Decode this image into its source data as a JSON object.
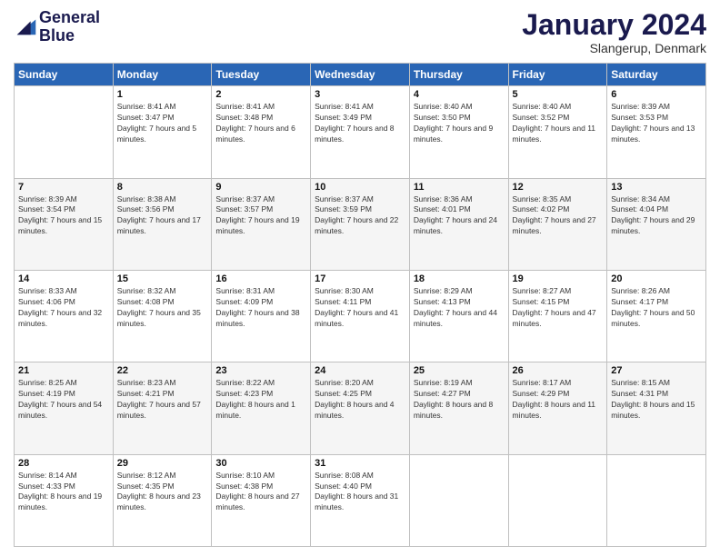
{
  "header": {
    "logo_line1": "General",
    "logo_line2": "Blue",
    "month": "January 2024",
    "location": "Slangerup, Denmark"
  },
  "weekdays": [
    "Sunday",
    "Monday",
    "Tuesday",
    "Wednesday",
    "Thursday",
    "Friday",
    "Saturday"
  ],
  "rows": [
    [
      {
        "day": "",
        "sunrise": "",
        "sunset": "",
        "daylight": ""
      },
      {
        "day": "1",
        "sunrise": "Sunrise: 8:41 AM",
        "sunset": "Sunset: 3:47 PM",
        "daylight": "Daylight: 7 hours and 5 minutes."
      },
      {
        "day": "2",
        "sunrise": "Sunrise: 8:41 AM",
        "sunset": "Sunset: 3:48 PM",
        "daylight": "Daylight: 7 hours and 6 minutes."
      },
      {
        "day": "3",
        "sunrise": "Sunrise: 8:41 AM",
        "sunset": "Sunset: 3:49 PM",
        "daylight": "Daylight: 7 hours and 8 minutes."
      },
      {
        "day": "4",
        "sunrise": "Sunrise: 8:40 AM",
        "sunset": "Sunset: 3:50 PM",
        "daylight": "Daylight: 7 hours and 9 minutes."
      },
      {
        "day": "5",
        "sunrise": "Sunrise: 8:40 AM",
        "sunset": "Sunset: 3:52 PM",
        "daylight": "Daylight: 7 hours and 11 minutes."
      },
      {
        "day": "6",
        "sunrise": "Sunrise: 8:39 AM",
        "sunset": "Sunset: 3:53 PM",
        "daylight": "Daylight: 7 hours and 13 minutes."
      }
    ],
    [
      {
        "day": "7",
        "sunrise": "Sunrise: 8:39 AM",
        "sunset": "Sunset: 3:54 PM",
        "daylight": "Daylight: 7 hours and 15 minutes."
      },
      {
        "day": "8",
        "sunrise": "Sunrise: 8:38 AM",
        "sunset": "Sunset: 3:56 PM",
        "daylight": "Daylight: 7 hours and 17 minutes."
      },
      {
        "day": "9",
        "sunrise": "Sunrise: 8:37 AM",
        "sunset": "Sunset: 3:57 PM",
        "daylight": "Daylight: 7 hours and 19 minutes."
      },
      {
        "day": "10",
        "sunrise": "Sunrise: 8:37 AM",
        "sunset": "Sunset: 3:59 PM",
        "daylight": "Daylight: 7 hours and 22 minutes."
      },
      {
        "day": "11",
        "sunrise": "Sunrise: 8:36 AM",
        "sunset": "Sunset: 4:01 PM",
        "daylight": "Daylight: 7 hours and 24 minutes."
      },
      {
        "day": "12",
        "sunrise": "Sunrise: 8:35 AM",
        "sunset": "Sunset: 4:02 PM",
        "daylight": "Daylight: 7 hours and 27 minutes."
      },
      {
        "day": "13",
        "sunrise": "Sunrise: 8:34 AM",
        "sunset": "Sunset: 4:04 PM",
        "daylight": "Daylight: 7 hours and 29 minutes."
      }
    ],
    [
      {
        "day": "14",
        "sunrise": "Sunrise: 8:33 AM",
        "sunset": "Sunset: 4:06 PM",
        "daylight": "Daylight: 7 hours and 32 minutes."
      },
      {
        "day": "15",
        "sunrise": "Sunrise: 8:32 AM",
        "sunset": "Sunset: 4:08 PM",
        "daylight": "Daylight: 7 hours and 35 minutes."
      },
      {
        "day": "16",
        "sunrise": "Sunrise: 8:31 AM",
        "sunset": "Sunset: 4:09 PM",
        "daylight": "Daylight: 7 hours and 38 minutes."
      },
      {
        "day": "17",
        "sunrise": "Sunrise: 8:30 AM",
        "sunset": "Sunset: 4:11 PM",
        "daylight": "Daylight: 7 hours and 41 minutes."
      },
      {
        "day": "18",
        "sunrise": "Sunrise: 8:29 AM",
        "sunset": "Sunset: 4:13 PM",
        "daylight": "Daylight: 7 hours and 44 minutes."
      },
      {
        "day": "19",
        "sunrise": "Sunrise: 8:27 AM",
        "sunset": "Sunset: 4:15 PM",
        "daylight": "Daylight: 7 hours and 47 minutes."
      },
      {
        "day": "20",
        "sunrise": "Sunrise: 8:26 AM",
        "sunset": "Sunset: 4:17 PM",
        "daylight": "Daylight: 7 hours and 50 minutes."
      }
    ],
    [
      {
        "day": "21",
        "sunrise": "Sunrise: 8:25 AM",
        "sunset": "Sunset: 4:19 PM",
        "daylight": "Daylight: 7 hours and 54 minutes."
      },
      {
        "day": "22",
        "sunrise": "Sunrise: 8:23 AM",
        "sunset": "Sunset: 4:21 PM",
        "daylight": "Daylight: 7 hours and 57 minutes."
      },
      {
        "day": "23",
        "sunrise": "Sunrise: 8:22 AM",
        "sunset": "Sunset: 4:23 PM",
        "daylight": "Daylight: 8 hours and 1 minute."
      },
      {
        "day": "24",
        "sunrise": "Sunrise: 8:20 AM",
        "sunset": "Sunset: 4:25 PM",
        "daylight": "Daylight: 8 hours and 4 minutes."
      },
      {
        "day": "25",
        "sunrise": "Sunrise: 8:19 AM",
        "sunset": "Sunset: 4:27 PM",
        "daylight": "Daylight: 8 hours and 8 minutes."
      },
      {
        "day": "26",
        "sunrise": "Sunrise: 8:17 AM",
        "sunset": "Sunset: 4:29 PM",
        "daylight": "Daylight: 8 hours and 11 minutes."
      },
      {
        "day": "27",
        "sunrise": "Sunrise: 8:15 AM",
        "sunset": "Sunset: 4:31 PM",
        "daylight": "Daylight: 8 hours and 15 minutes."
      }
    ],
    [
      {
        "day": "28",
        "sunrise": "Sunrise: 8:14 AM",
        "sunset": "Sunset: 4:33 PM",
        "daylight": "Daylight: 8 hours and 19 minutes."
      },
      {
        "day": "29",
        "sunrise": "Sunrise: 8:12 AM",
        "sunset": "Sunset: 4:35 PM",
        "daylight": "Daylight: 8 hours and 23 minutes."
      },
      {
        "day": "30",
        "sunrise": "Sunrise: 8:10 AM",
        "sunset": "Sunset: 4:38 PM",
        "daylight": "Daylight: 8 hours and 27 minutes."
      },
      {
        "day": "31",
        "sunrise": "Sunrise: 8:08 AM",
        "sunset": "Sunset: 4:40 PM",
        "daylight": "Daylight: 8 hours and 31 minutes."
      },
      {
        "day": "",
        "sunrise": "",
        "sunset": "",
        "daylight": ""
      },
      {
        "day": "",
        "sunrise": "",
        "sunset": "",
        "daylight": ""
      },
      {
        "day": "",
        "sunrise": "",
        "sunset": "",
        "daylight": ""
      }
    ]
  ]
}
